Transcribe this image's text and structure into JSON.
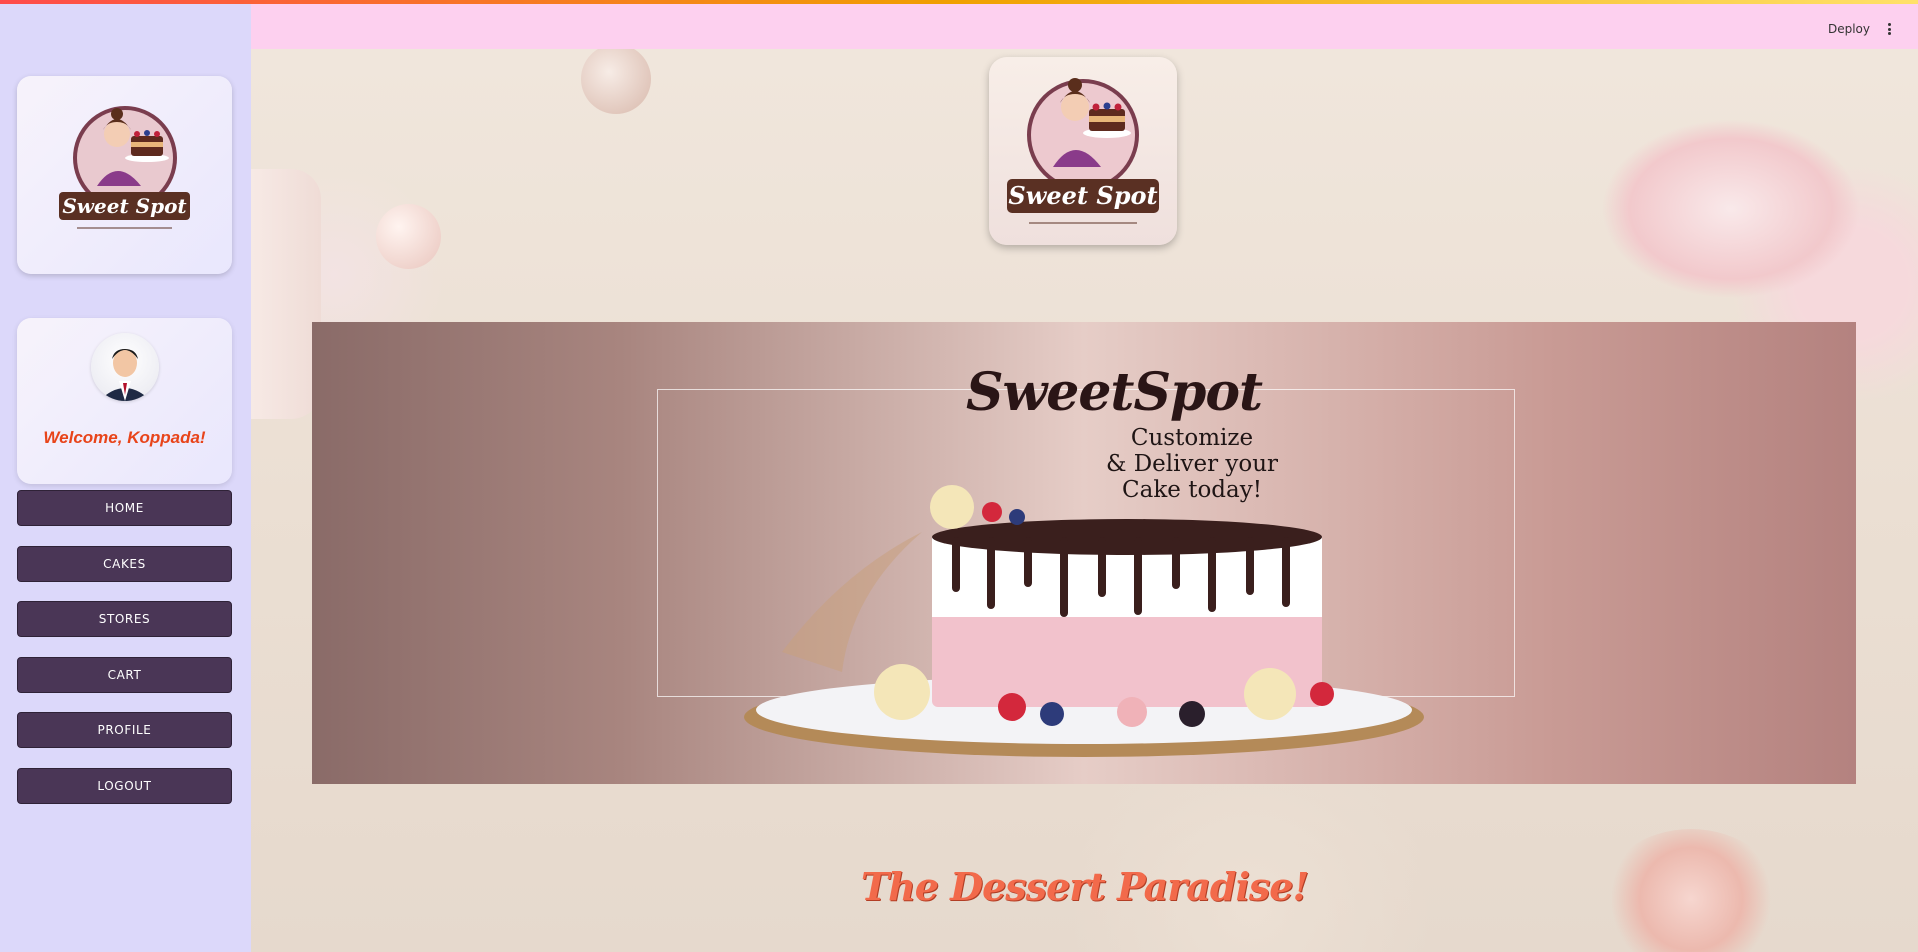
{
  "header": {
    "deploy_label": "Deploy"
  },
  "sidebar": {
    "logo_text": "Sweet Spot",
    "welcome_text": "Welcome, Koppada!",
    "nav": [
      {
        "label": "HOME"
      },
      {
        "label": "CAKES"
      },
      {
        "label": "STORES"
      },
      {
        "label": "CART"
      },
      {
        "label": "PROFILE"
      },
      {
        "label": "LOGOUT"
      }
    ]
  },
  "main": {
    "logo_text": "Sweet Spot",
    "banner": {
      "title": "SweetSpot",
      "subtitle_line1": "Customize",
      "subtitle_line2": "& Deliver your",
      "subtitle_line3": "Cake today!"
    },
    "tagline": "The Dessert Paradise!"
  },
  "colors": {
    "sidebar_bg": "#dcd8fa",
    "header_bg": "#fdd0ef",
    "nav_button": "#4a3656",
    "welcome_text": "#e8441a",
    "tagline": "#f26a4b"
  }
}
